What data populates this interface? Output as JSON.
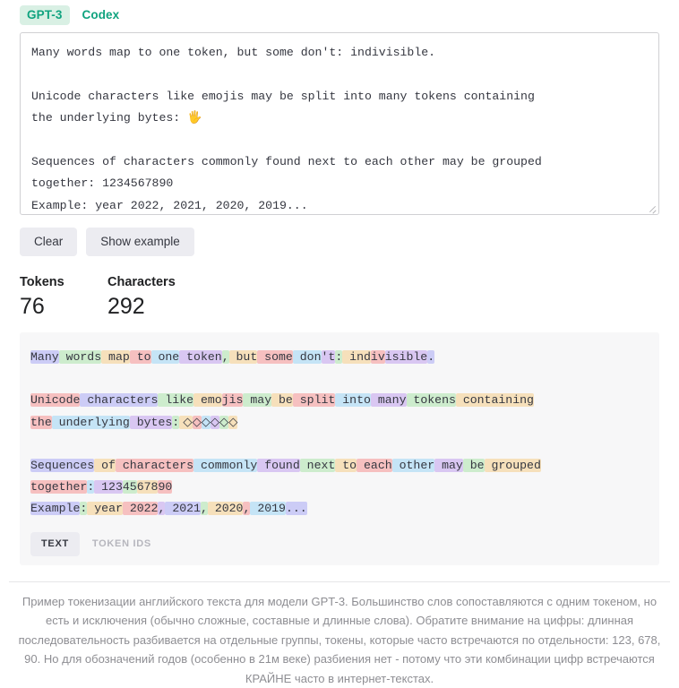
{
  "model_tabs": [
    {
      "label": "GPT-3",
      "active": true
    },
    {
      "label": "Codex",
      "active": false
    }
  ],
  "input": {
    "value": "Many words map to one token, but some don't: indivisible.\n\nUnicode characters like emojis may be split into many tokens containing the underlying bytes: 🖐\n\nSequences of characters commonly found next to each other may be grouped together: 1234567890\nExample: year 2022, 2021, 2020, 2019...",
    "line1": "Many words map to one token, but some don't: indivisible.",
    "line2": "Unicode characters like emojis may be split into many tokens containing",
    "line3": "the underlying bytes: ",
    "emoji": "🖐",
    "line4": "Sequences of characters commonly found next to each other may be grouped",
    "line5": "together: 1234567890",
    "line6": "Example: year 2022, 2021, 2020, 2019..."
  },
  "buttons": {
    "clear": "Clear",
    "show_example": "Show example"
  },
  "stats": {
    "tokens_label": "Tokens",
    "tokens_value": "76",
    "characters_label": "Characters",
    "characters_value": "292"
  },
  "view_tabs": [
    {
      "label": "TEXT",
      "active": true
    },
    {
      "label": "TOKEN IDS",
      "active": false
    }
  ],
  "token_colors": {
    "lavender": "#ccccf6",
    "green": "#cdeccd",
    "tan": "#f6e0bb",
    "pink": "#f6c0c0",
    "blue": "#c5e4f6",
    "purple": "#d9c7f2",
    "teal": "#bfe8e0",
    "none": "transparent"
  },
  "tokenized": [
    {
      "t": "Many",
      "c": "lavender"
    },
    {
      "t": " words",
      "c": "green"
    },
    {
      "t": " map",
      "c": "tan"
    },
    {
      "t": " to",
      "c": "pink"
    },
    {
      "t": " one",
      "c": "blue"
    },
    {
      "t": " token",
      "c": "purple"
    },
    {
      "t": ",",
      "c": "green"
    },
    {
      "t": " but",
      "c": "tan"
    },
    {
      "t": " some",
      "c": "pink"
    },
    {
      "t": " don",
      "c": "blue"
    },
    {
      "t": "'t",
      "c": "purple"
    },
    {
      "t": ":",
      "c": "green"
    },
    {
      "t": " ind",
      "c": "tan"
    },
    {
      "t": "iv",
      "c": "pink"
    },
    {
      "t": "isible",
      "c": "purple"
    },
    {
      "t": ".",
      "c": "lavender"
    },
    {
      "t": "\n\n",
      "c": "none"
    },
    {
      "t": "Unicode",
      "c": "pink"
    },
    {
      "t": " characters",
      "c": "lavender"
    },
    {
      "t": " like",
      "c": "green"
    },
    {
      "t": " emo",
      "c": "tan"
    },
    {
      "t": "jis",
      "c": "pink"
    },
    {
      "t": " may",
      "c": "green"
    },
    {
      "t": " be",
      "c": "tan"
    },
    {
      "t": " split",
      "c": "pink"
    },
    {
      "t": " into",
      "c": "blue"
    },
    {
      "t": " many",
      "c": "purple"
    },
    {
      "t": " tokens",
      "c": "green"
    },
    {
      "t": " containing",
      "c": "tan"
    },
    {
      "t": "\n",
      "c": "none"
    },
    {
      "t": "the",
      "c": "pink"
    },
    {
      "t": " underlying",
      "c": "blue"
    },
    {
      "t": " bytes",
      "c": "purple"
    },
    {
      "t": ":",
      "c": "green"
    },
    {
      "t": " ◇",
      "c": "tan"
    },
    {
      "t": "◇",
      "c": "pink"
    },
    {
      "t": "◇",
      "c": "blue"
    },
    {
      "t": "◇",
      "c": "purple"
    },
    {
      "t": "◇",
      "c": "green"
    },
    {
      "t": "◇",
      "c": "tan"
    },
    {
      "t": "\n\n",
      "c": "none"
    },
    {
      "t": "Sequences",
      "c": "lavender"
    },
    {
      "t": " of",
      "c": "tan"
    },
    {
      "t": " characters",
      "c": "pink"
    },
    {
      "t": " commonly",
      "c": "blue"
    },
    {
      "t": " found",
      "c": "purple"
    },
    {
      "t": " next",
      "c": "green"
    },
    {
      "t": " to",
      "c": "tan"
    },
    {
      "t": " each",
      "c": "pink"
    },
    {
      "t": " other",
      "c": "blue"
    },
    {
      "t": " may",
      "c": "purple"
    },
    {
      "t": " be",
      "c": "green"
    },
    {
      "t": " grouped",
      "c": "tan"
    },
    {
      "t": "\n",
      "c": "none"
    },
    {
      "t": "together",
      "c": "pink"
    },
    {
      "t": ":",
      "c": "blue"
    },
    {
      "t": " 123",
      "c": "purple"
    },
    {
      "t": "45",
      "c": "green"
    },
    {
      "t": "678",
      "c": "tan"
    },
    {
      "t": "90",
      "c": "pink"
    },
    {
      "t": "\n",
      "c": "none"
    },
    {
      "t": "Example",
      "c": "lavender"
    },
    {
      "t": ":",
      "c": "green"
    },
    {
      "t": " year",
      "c": "tan"
    },
    {
      "t": " 2022",
      "c": "pink"
    },
    {
      "t": ",",
      "c": "purple"
    },
    {
      "t": " 2021",
      "c": "lavender"
    },
    {
      "t": ",",
      "c": "green"
    },
    {
      "t": " 2020",
      "c": "tan"
    },
    {
      "t": ",",
      "c": "pink"
    },
    {
      "t": " 2019",
      "c": "blue"
    },
    {
      "t": "...",
      "c": "lavender"
    }
  ],
  "caption": "Пример токенизации английского текста для модели GPT-3. Большинство слов сопоставляются с одним токеном, но есть и исключения (обычно сложные, составные и длинные слова). Обратите внимание на цифры: длинная последовательность разбивается на отдельные группы, токены, которые часто встречаются по отдельности: 123, 678, 90. Но для обозначений годов (особенно в 21м веке) разбиения нет - потому что эти комбинации цифр встречаются КРАЙНЕ часто в интернет-текстах."
}
